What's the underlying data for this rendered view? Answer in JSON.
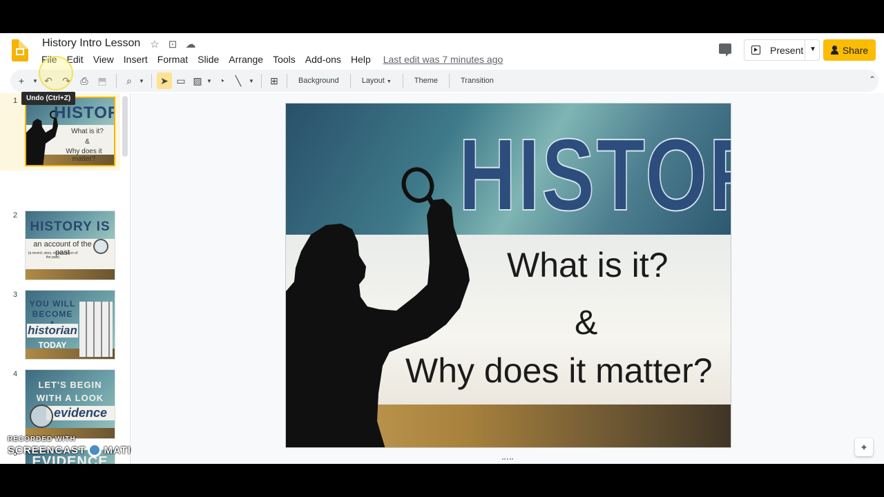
{
  "document": {
    "title": "History Intro Lesson",
    "last_edit": "Last edit was 7 minutes ago"
  },
  "menu": [
    "File",
    "Edit",
    "View",
    "Insert",
    "Format",
    "Slide",
    "Arrange",
    "Tools",
    "Add-ons",
    "Help"
  ],
  "header": {
    "present_label": "Present",
    "share_label": "Share"
  },
  "toolbar": {
    "background_label": "Background",
    "layout_label": "Layout",
    "theme_label": "Theme",
    "transition_label": "Transition",
    "tooltip": "Undo (Ctrl+Z)"
  },
  "slides": [
    {
      "number": "1",
      "heading": "HISTORY",
      "lines": [
        "What is it?",
        "&",
        "Why does it matter?"
      ]
    },
    {
      "number": "2",
      "heading": "HISTORY IS",
      "lines": [
        "an account of the past",
        "(a record, story, or description of the past)"
      ]
    },
    {
      "number": "3",
      "heading": "YOU WILL BECOME A",
      "lines": [
        "historian",
        "TODAY"
      ]
    },
    {
      "number": "4",
      "heading": "LET'S BEGIN WITH A LOOK AT",
      "lines": [
        "evidence"
      ]
    },
    {
      "number": "5",
      "heading": "EVIDENCE",
      "lines": []
    }
  ],
  "main_slide": {
    "heading": "HISTORY",
    "line1": "What is it?",
    "line2": "&",
    "line3": "Why does it matter?"
  },
  "watermark": {
    "top": "RECORDED WITH",
    "left": "SCREENCAST",
    "right": "MATIC"
  },
  "colors": {
    "accent_yellow": "#fbbc04",
    "heading_blue": "#2d4d7c"
  }
}
